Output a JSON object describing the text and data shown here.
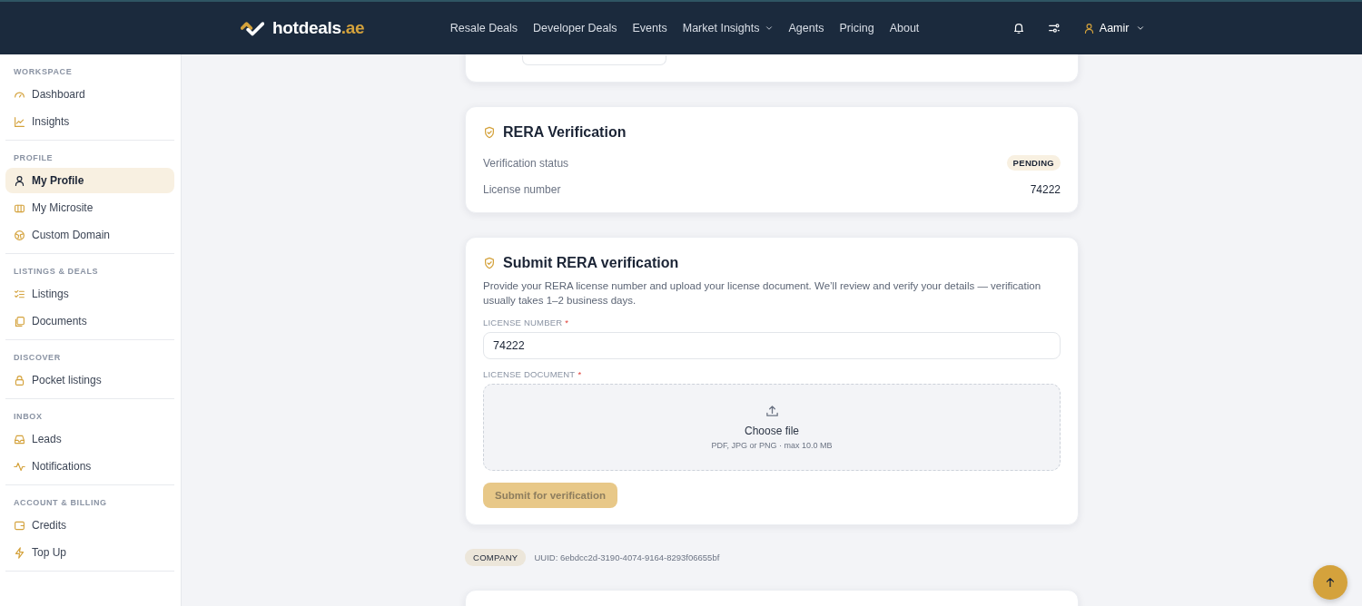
{
  "header": {
    "logo": {
      "text": "hotdeals",
      "suffix": ".ae"
    },
    "nav": [
      {
        "label": "Resale Deals",
        "has_menu": false
      },
      {
        "label": "Developer Deals",
        "has_menu": false
      },
      {
        "label": "Events",
        "has_menu": false
      },
      {
        "label": "Market Insights",
        "has_menu": true
      },
      {
        "label": "Agents",
        "has_menu": false
      },
      {
        "label": "Pricing",
        "has_menu": false
      },
      {
        "label": "About",
        "has_menu": false
      }
    ],
    "user": {
      "name": "Aamir"
    }
  },
  "sidebar": {
    "sections": [
      {
        "title": "WORKSPACE",
        "items": [
          {
            "label": "Dashboard",
            "selected": false
          },
          {
            "label": "Insights",
            "selected": false
          }
        ]
      },
      {
        "title": "PROFILE",
        "items": [
          {
            "label": "My Profile",
            "selected": true
          },
          {
            "label": "My Microsite",
            "selected": false
          },
          {
            "label": "Custom Domain",
            "selected": false
          }
        ]
      },
      {
        "title": "LISTINGS & DEALS",
        "items": [
          {
            "label": "Listings",
            "selected": false
          },
          {
            "label": "Documents",
            "selected": false
          }
        ]
      },
      {
        "title": "DISCOVER",
        "items": [
          {
            "label": "Pocket listings",
            "selected": false
          }
        ]
      },
      {
        "title": "INBOX",
        "items": [
          {
            "label": "Leads",
            "selected": false
          },
          {
            "label": "Notifications",
            "selected": false
          }
        ]
      },
      {
        "title": "ACCOUNT & BILLING",
        "items": [
          {
            "label": "Credits",
            "selected": false
          },
          {
            "label": "Top Up",
            "selected": false
          }
        ]
      }
    ]
  },
  "rera_card": {
    "title": "RERA Verification",
    "rows": [
      {
        "label": "Verification status",
        "value": "PENDING",
        "kind": "badge"
      },
      {
        "label": "License number",
        "value": "74222",
        "kind": "text"
      }
    ]
  },
  "submit_card": {
    "title": "Submit RERA verification",
    "description": "Provide your RERA license number and upload your license document. We’ll review and verify your details — verification usually takes 1–2 business days.",
    "fields": [
      {
        "label": "LICENSE NUMBER",
        "required_mark": "*",
        "kind": "input",
        "value": "74222"
      },
      {
        "label": "LICENSE DOCUMENT",
        "required_mark": "*",
        "kind": "upload",
        "action": "Choose file",
        "hint": "PDF, JPG or PNG · max 10.0 MB"
      }
    ],
    "submit_button": {
      "label": "Submit for verification",
      "disabled": true
    }
  },
  "company": {
    "tag": "COMPANY",
    "uuid": "UUID: 6ebdcc2d-3190-4074-9164-8293f06655bf"
  }
}
